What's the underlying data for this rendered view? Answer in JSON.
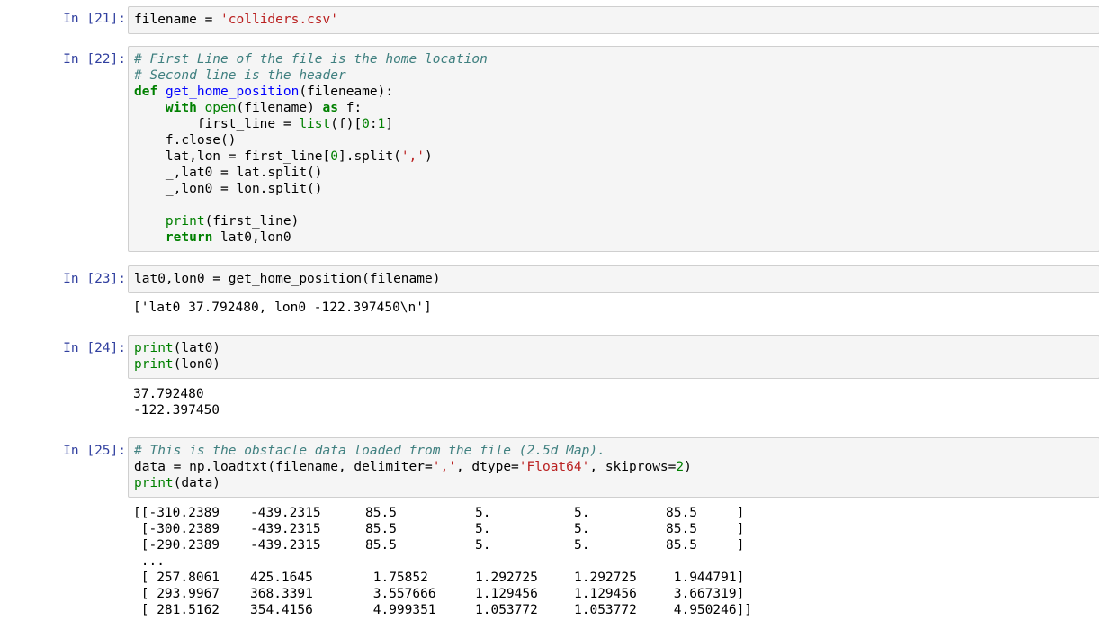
{
  "cells": [
    {
      "prompt": "In [21]:"
    },
    {
      "prompt": "In [22]:"
    },
    {
      "prompt": "In [23]:"
    },
    {
      "prompt": "In [24]:"
    },
    {
      "prompt": "In [25]:"
    }
  ],
  "c21": {
    "var": "filename",
    "eq": " = ",
    "str": "'colliders.csv'"
  },
  "c22": {
    "comment1": "# First Line of the file is the home location",
    "comment2": "# Second line is the header",
    "def": "def",
    "fname": "get_home_position",
    "sig": "(fileneame):",
    "l4_indent": "    ",
    "with": "with",
    "open": "open",
    "open_args": "(filename) ",
    "as": "as",
    "as_rest": " f:",
    "l5_a": "        first_line = ",
    "list": "list",
    "l5_b": "(f)[",
    "l5_n0": "0",
    "l5_c": ":",
    "l5_n1": "1",
    "l5_d": "]",
    "l6": "    f.close()",
    "l7_a": "    lat,lon = first_line[",
    "l7_n": "0",
    "l7_b": "].split(",
    "l7_s": "','",
    "l7_c": ")",
    "l8": "    _,lat0 = lat.split()",
    "l9": "    _,lon0 = lon.split()",
    "l11_indent": "    ",
    "print": "print",
    "l11_rest": "(first_line)",
    "l12_indent": "    ",
    "return": "return",
    "l12_rest": " lat0,lon0"
  },
  "c23": {
    "code": "lat0,lon0 = get_home_position(filename)",
    "out": "['lat0 37.792480, lon0 -122.397450\\n']"
  },
  "c24": {
    "print": "print",
    "a1": "(lat0)",
    "a2": "(lon0)",
    "out1": "37.792480",
    "out2": "-122.397450"
  },
  "c25": {
    "comment": "# This is the obstacle data loaded from the file (2.5d Map).",
    "l2_a": "data = np.loadtxt(filename, delimiter=",
    "l2_s1": "','",
    "l2_b": ", dtype=",
    "l2_s2": "'Float64'",
    "l2_c": ", skiprows=",
    "l2_n": "2",
    "l2_d": ")",
    "print": "print",
    "l3_rest": "(data)",
    "rows": [
      [
        "[[-310.2389",
        "-439.2315",
        "85.5",
        "5.",
        "5.",
        "85.5     ]"
      ],
      [
        " [-300.2389",
        "-439.2315",
        "85.5",
        "5.",
        "5.",
        "85.5     ]"
      ],
      [
        " [-290.2389",
        "-439.2315",
        "85.5",
        "5.",
        "5.",
        "85.5     ]"
      ],
      [
        " ...",
        "",
        "",
        "",
        "",
        ""
      ],
      [
        " [ 257.8061",
        "425.1645",
        " 1.75852",
        "1.292725",
        "1.292725",
        " 1.944791]"
      ],
      [
        " [ 293.9967",
        "368.3391",
        " 3.557666",
        "1.129456",
        "1.129456",
        " 3.667319]"
      ],
      [
        " [ 281.5162",
        "354.4156",
        " 4.999351",
        "1.053772",
        "1.053772",
        " 4.950246]]"
      ]
    ]
  }
}
